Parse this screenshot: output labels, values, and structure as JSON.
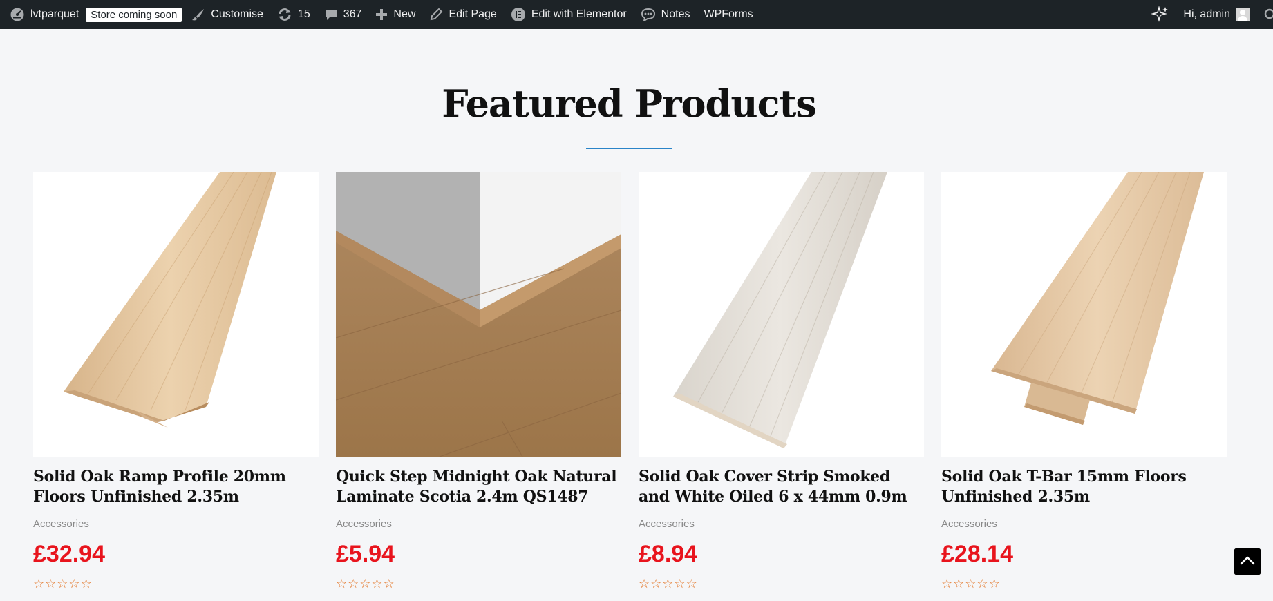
{
  "adminbar": {
    "site_name": "lvtparquet",
    "store_badge": "Store coming soon",
    "customise": "Customise",
    "updates_count": "15",
    "comments_count": "367",
    "new": "New",
    "edit_page": "Edit Page",
    "edit_elementor": "Edit with Elementor",
    "notes": "Notes",
    "wpforms": "WPForms",
    "greeting": "Hi, admin"
  },
  "section": {
    "title": "Featured Products",
    "accent_color": "#2a84c8"
  },
  "products": [
    {
      "title": "Solid Oak Ramp Profile 20mm Floors Unfinished 2.35m",
      "category": "Accessories",
      "price": "£32.94",
      "rating": 0
    },
    {
      "title": "Quick Step Midnight Oak Natural Laminate Scotia 2.4m QS1487",
      "category": "Accessories",
      "price": "£5.94",
      "rating": 0
    },
    {
      "title": "Solid Oak Cover Strip Smoked and White Oiled 6 x 44mm 0.9m",
      "category": "Accessories",
      "price": "£8.94",
      "rating": 0
    },
    {
      "title": "Solid Oak T-Bar 15mm Floors Unfinished 2.35m",
      "category": "Accessories",
      "price": "£28.14",
      "rating": 0
    }
  ],
  "colors": {
    "price": "#e8141d",
    "star": "#e47a2e",
    "adminbar": "#1d2327"
  }
}
